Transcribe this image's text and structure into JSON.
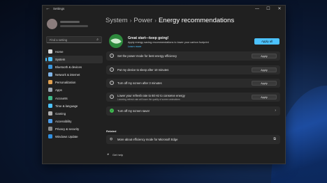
{
  "window": {
    "title": "Settings",
    "back_glyph": "←",
    "controls": {
      "minimize": "—",
      "maximize": "☐",
      "close": "✕"
    }
  },
  "sidebar": {
    "search_placeholder": "Find a setting",
    "search_icon": "⌕",
    "items": [
      {
        "label": "Home",
        "icon": "home-icon",
        "color": "#d9d9d9"
      },
      {
        "label": "System",
        "icon": "system-icon",
        "color": "#4cc2ff",
        "active": true
      },
      {
        "label": "Bluetooth & devices",
        "icon": "bluetooth-icon",
        "color": "#3a96dd"
      },
      {
        "label": "Network & internet",
        "icon": "network-icon",
        "color": "#7fb4e8"
      },
      {
        "label": "Personalization",
        "icon": "personalization-icon",
        "color": "#e0a050"
      },
      {
        "label": "Apps",
        "icon": "apps-icon",
        "color": "#9aa5b1"
      },
      {
        "label": "Accounts",
        "icon": "accounts-icon",
        "color": "#3fb98a"
      },
      {
        "label": "Time & language",
        "icon": "time-language-icon",
        "color": "#4cc2ff"
      },
      {
        "label": "Gaming",
        "icon": "gaming-icon",
        "color": "#b0b0b0"
      },
      {
        "label": "Accessibility",
        "icon": "accessibility-icon",
        "color": "#4c9be8"
      },
      {
        "label": "Privacy & security",
        "icon": "privacy-icon",
        "color": "#8a8a8a"
      },
      {
        "label": "Windows Update",
        "icon": "windows-update-icon",
        "color": "#2f8fe0"
      }
    ]
  },
  "breadcrumb": {
    "part1": "System",
    "part2": "Power",
    "current": "Energy recommendations",
    "sep": "›"
  },
  "hero": {
    "title": "Great start—keep going!",
    "description": "Apply energy saving recommendations to lower your carbon footprint",
    "link": "Learn more",
    "apply_all": "Apply all",
    "icon": "leaf-icon"
  },
  "recommendations": [
    {
      "text": "Set the power mode for best energy efficiency",
      "button": "Apply",
      "done": false
    },
    {
      "text": "Put my device to sleep after 10 minutes",
      "button": "Apply",
      "done": false
    },
    {
      "text": "Turn off my screen after 3 minutes",
      "button": "Apply",
      "done": false
    },
    {
      "text": "Lower your refresh rate to 60 Hz to conserve energy",
      "subtext": "Lowering refresh rate will lower the quality of screen animations",
      "button": "Apply",
      "done": false
    },
    {
      "text": "Turn off my screen saver",
      "done": true,
      "chevron": "›"
    }
  ],
  "related": {
    "heading": "Related",
    "item": "More about efficiency mode for Microsoft Edge",
    "ext_icon": "⧉"
  },
  "help": {
    "label": "Get help",
    "icon": "help-icon"
  },
  "accent_color": "#4cc2ff"
}
